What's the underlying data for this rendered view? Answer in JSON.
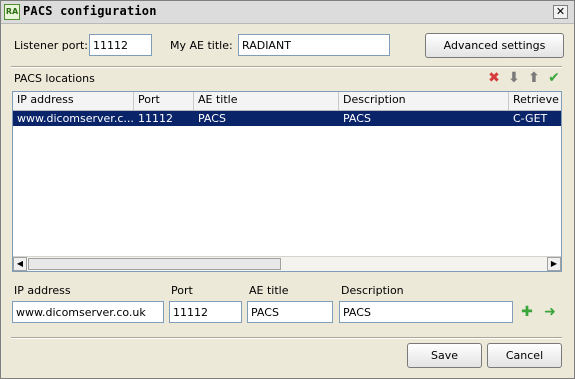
{
  "window": {
    "title": "PACS configuration",
    "icon_text": "RA",
    "close_glyph": "✕"
  },
  "listener": {
    "label": "Listener port:",
    "value": "11112"
  },
  "ae": {
    "label": "My AE title:",
    "value": "RADIANT"
  },
  "advanced_button": "Advanced settings",
  "locations": {
    "label": "PACS locations",
    "toolbar": [
      {
        "name": "delete-icon",
        "glyph": "✖",
        "color": "#d83b3b"
      },
      {
        "name": "move-down-icon",
        "glyph": "⬇",
        "color": "#7a7a7a"
      },
      {
        "name": "move-up-icon",
        "glyph": "⬆",
        "color": "#7a7a7a"
      },
      {
        "name": "check-icon",
        "glyph": "✔",
        "color": "#3aa53a"
      }
    ],
    "columns": [
      "IP address",
      "Port",
      "AE title",
      "Description",
      "Retrieve p"
    ],
    "rows": [
      [
        "www.dicomserver.c...",
        "11112",
        "PACS",
        "PACS",
        "C-GET"
      ]
    ],
    "selection_color": "#0a246a"
  },
  "form": {
    "ip_label": "IP address",
    "port_label": "Port",
    "ae_label": "AE title",
    "desc_label": "Description",
    "ip_value": "www.dicomserver.co.uk",
    "port_value": "11112",
    "ae_value": "PACS",
    "desc_value": "PACS",
    "add_glyph": "✚",
    "apply_glyph": "➜",
    "accent_green": "#3aa53a"
  },
  "buttons": {
    "save": "Save",
    "cancel": "Cancel"
  },
  "scroll": {
    "left_glyph": "◀",
    "right_glyph": "▶"
  }
}
